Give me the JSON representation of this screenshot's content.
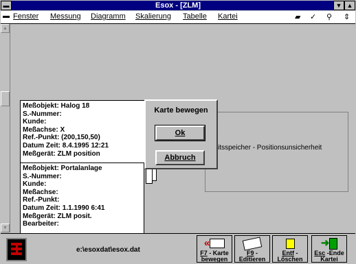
{
  "window": {
    "title": "Esox - [ZLM]"
  },
  "menu": {
    "items": [
      "Fenster",
      "Messung",
      "Diagramm",
      "Skalierung",
      "Tabelle",
      "Kartei"
    ]
  },
  "client": {
    "status_label": "Arbeitsspeicher - Positionsunsicherheit"
  },
  "cards": [
    {
      "rows": [
        "Meßobjekt:  Halog 18",
        "S.-Nummer:",
        "Kunde:",
        "Meßachse:  X",
        "Ref.-Punkt:  (200,150,50)",
        "Datum Zeit: 8.4.1995   12:21",
        "Meßgerät:    ZLM position"
      ]
    },
    {
      "rows": [
        "Meßobjekt:  Portalanlage",
        "S.-Nummer:",
        "Kunde:",
        "Meßachse:",
        "Ref.-Punkt:",
        "Datum Zeit: 1.1.1990   6:41",
        "Meßgerät:    ZLM posit.",
        "Bearbeiter:"
      ]
    }
  ],
  "dialog": {
    "title": "Karte bewegen",
    "ok_label": "Ok",
    "cancel_label": "Abbruch"
  },
  "footer": {
    "file_path": "e:\\esoxdat\\esox.dat",
    "buttons": [
      {
        "key": "F7",
        "label1": " - Karte",
        "label2": "bewegen",
        "icon": "move-card-icon"
      },
      {
        "key": "F9",
        "label1": " -",
        "label2": "Editieren",
        "icon": "edit-icon"
      },
      {
        "key": "Entf",
        "label1": " -",
        "label2": "Löschen",
        "icon": "trash-icon"
      },
      {
        "key": "Esc",
        "label1": " -Ende",
        "label2": "Kartei",
        "icon": "exit-door-icon"
      }
    ]
  }
}
